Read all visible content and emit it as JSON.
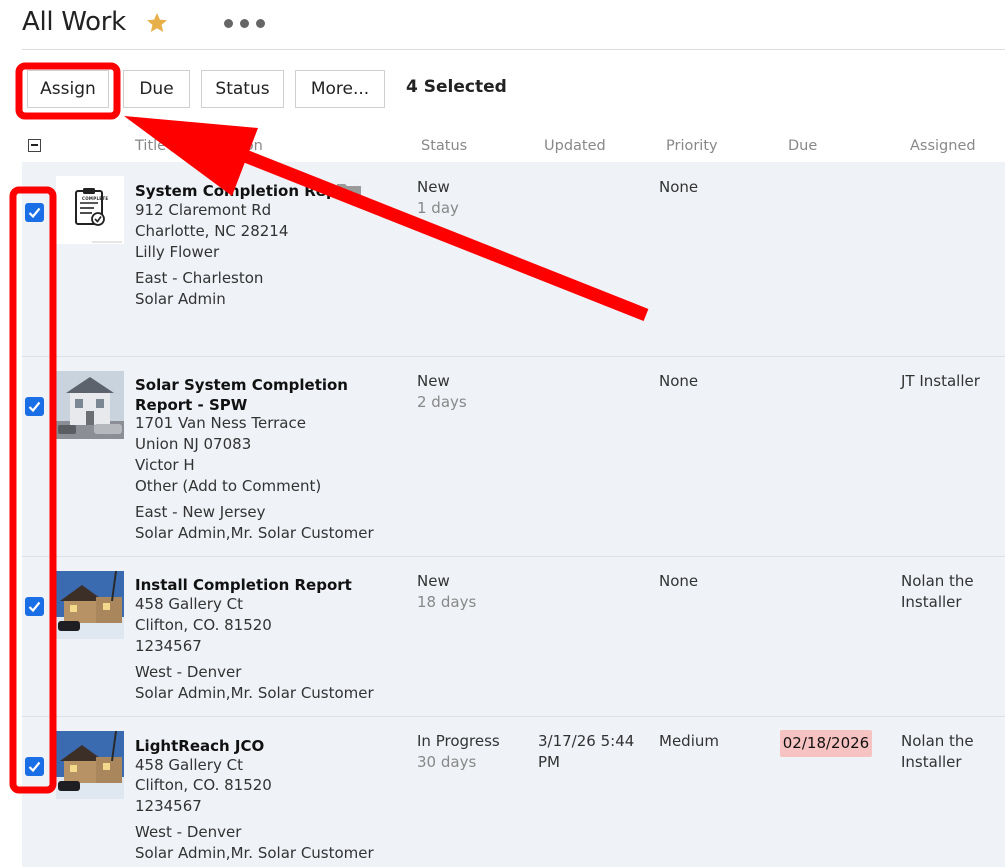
{
  "header": {
    "title": "All Work"
  },
  "toolbar": {
    "assign_label": "Assign",
    "due_label": "Due",
    "status_label": "Status",
    "more_label": "More...",
    "selected_text": "4 Selected"
  },
  "columns": {
    "title": "Title / Description",
    "status": "Status",
    "updated": "Updated",
    "priority": "Priority",
    "due": "Due",
    "assigned": "Assigned"
  },
  "rows": [
    {
      "title": "System Completion Report",
      "address1": "912 Claremont Rd",
      "address2": "Charlotte, NC 28214",
      "extra": "Lilly Flower",
      "region": "East - Charleston",
      "roles": "Solar Admin",
      "status": "New",
      "age": "1 day",
      "updated": "",
      "priority": "None",
      "due": "",
      "assigned": "",
      "checked": true
    },
    {
      "title": "Solar System Completion Report - SPW",
      "address1": "1701 Van Ness Terrace",
      "address2": "Union NJ 07083",
      "extra": "Victor H",
      "extra2": "Other (Add to Comment)",
      "region": "East - New Jersey",
      "roles": "Solar Admin,Mr. Solar Customer",
      "status": "New",
      "age": "2 days",
      "updated": "",
      "priority": "None",
      "due": "",
      "assigned": "JT Installer",
      "checked": true
    },
    {
      "title": "Install Completion Report",
      "address1": "458 Gallery Ct",
      "address2": "Clifton, CO. 81520",
      "extra": "1234567",
      "region": "West - Denver",
      "roles": "Solar Admin,Mr. Solar Customer",
      "status": "New",
      "age": "18 days",
      "updated": "",
      "priority": "None",
      "due": "",
      "assigned": "Nolan the Installer",
      "checked": true
    },
    {
      "title": "LightReach JCO",
      "address1": "458 Gallery Ct",
      "address2": "Clifton, CO. 81520",
      "extra": "1234567",
      "region": "West - Denver",
      "roles": "Solar Admin,Mr. Solar Customer",
      "status": "In Progress",
      "age": "30 days",
      "updated": "3/17/26 5:44 PM",
      "priority": "Medium",
      "due": "02/18/2026",
      "assigned": "Nolan the Installer",
      "checked": true
    }
  ],
  "thumbnails": {
    "report_doc_label": "COMPLETE"
  },
  "colors": {
    "accent": "#1a6ee6",
    "annotation": "#ff0000",
    "star": "#e8b04b",
    "due_overdue": "#f7c2c2"
  },
  "icons": [
    "star-icon",
    "more-icon",
    "folder-icon",
    "checkbox-checked-icon",
    "clipboard-icon"
  ]
}
